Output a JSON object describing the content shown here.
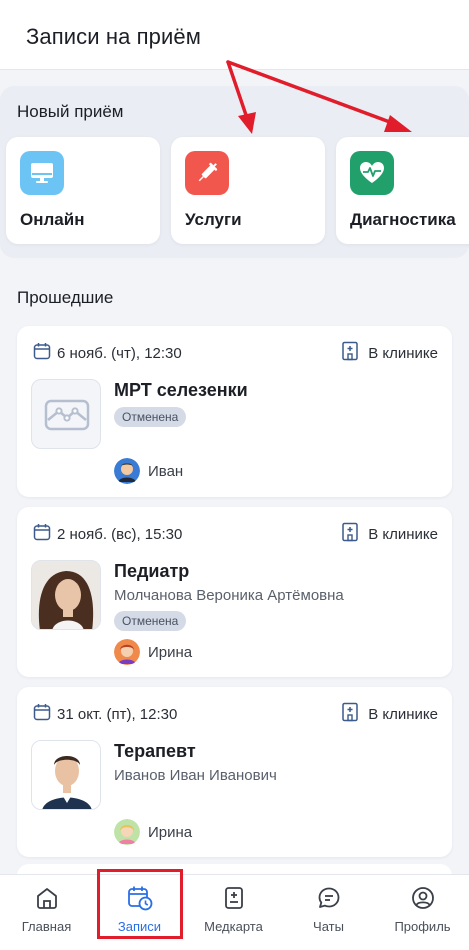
{
  "header": {
    "title": "Записи на приём"
  },
  "new_appointment": {
    "title": "Новый приём",
    "cards": [
      {
        "label": "Онлайн",
        "icon": "monitor-icon",
        "color": "#6cc4f5"
      },
      {
        "label": "Услуги",
        "icon": "syringe-icon",
        "color": "#f2574e"
      },
      {
        "label": "Диагностика",
        "icon": "heart-pulse-icon",
        "color": "#22a06b"
      }
    ]
  },
  "past": {
    "title": "Прошедшие",
    "appointments": [
      {
        "date": "6 нояб. (чт), 12:30",
        "place": "В клинике",
        "title": "МРТ селезенки",
        "doctor": "",
        "status": "Отменена",
        "patient": "Иван"
      },
      {
        "date": "2 нояб. (вс), 15:30",
        "place": "В клинике",
        "title": "Педиатр",
        "doctor": "Молчанова Вероника Артёмовна",
        "status": "Отменена",
        "patient": "Ирина"
      },
      {
        "date": "31 окт. (пт), 12:30",
        "place": "В клинике",
        "title": "Терапевт",
        "doctor": "Иванов Иван Иванович",
        "status": "",
        "patient": "Ирина"
      }
    ]
  },
  "tabs": [
    {
      "label": "Главная",
      "icon": "home-icon",
      "active": false
    },
    {
      "label": "Записи",
      "icon": "calendar-clock-icon",
      "active": true
    },
    {
      "label": "Медкарта",
      "icon": "medical-card-icon",
      "active": false
    },
    {
      "label": "Чаты",
      "icon": "chat-icon",
      "active": false
    },
    {
      "label": "Профиль",
      "icon": "profile-icon",
      "active": false
    }
  ],
  "colors": {
    "accent": "#2b6fe6",
    "annotation_red": "#e11d2b",
    "badge_bg": "#d4dae6"
  }
}
